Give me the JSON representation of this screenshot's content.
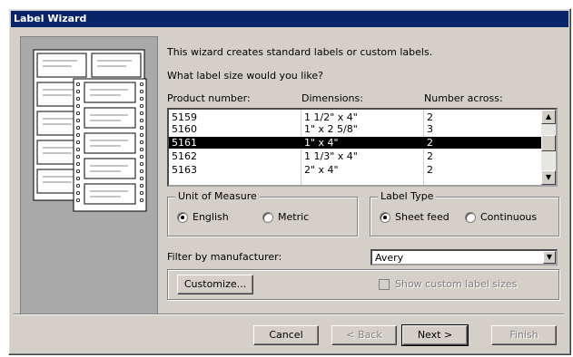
{
  "window": {
    "title": "Label Wizard"
  },
  "intro": {
    "line1": "This wizard creates standard labels or custom labels.",
    "question": "What label size would you like?"
  },
  "list": {
    "headers": [
      "Product number:",
      "Dimensions:",
      "Number across:"
    ],
    "rows": [
      {
        "product": "5159",
        "dimensions": "1 1/2\" x 4\"",
        "across": "2"
      },
      {
        "product": "5160",
        "dimensions": "1\" x 2 5/8\"",
        "across": "3"
      },
      {
        "product": "5161",
        "dimensions": "1\" x 4\"",
        "across": "2"
      },
      {
        "product": "5162",
        "dimensions": "1 1/3\" x 4\"",
        "across": "2"
      },
      {
        "product": "5163",
        "dimensions": "2\" x 4\"",
        "across": "2"
      }
    ],
    "selected_index": 2
  },
  "unit_of_measure": {
    "legend": "Unit of Measure",
    "english": "English",
    "metric": "Metric",
    "selected": "English"
  },
  "label_type": {
    "legend": "Label Type",
    "sheet": "Sheet feed",
    "continuous": "Continuous",
    "selected": "Sheet feed"
  },
  "filter": {
    "label": "Filter by manufacturer:",
    "value": "Avery"
  },
  "customize": {
    "button": "Customize...",
    "show_custom": "Show custom label sizes",
    "show_custom_checked": false
  },
  "buttons": {
    "cancel": "Cancel",
    "back": "< Back",
    "next": "Next >",
    "finish": "Finish"
  },
  "icons": {
    "scroll_up": "scroll-up-arrow-icon",
    "scroll_down": "scroll-down-arrow-icon",
    "combo_arrow": "chevron-down-icon",
    "illustration": "label-sheet-illustration"
  },
  "colors": {
    "titlebar": "#0a246a",
    "face": "#d4d0c8",
    "selection": "#000000"
  }
}
